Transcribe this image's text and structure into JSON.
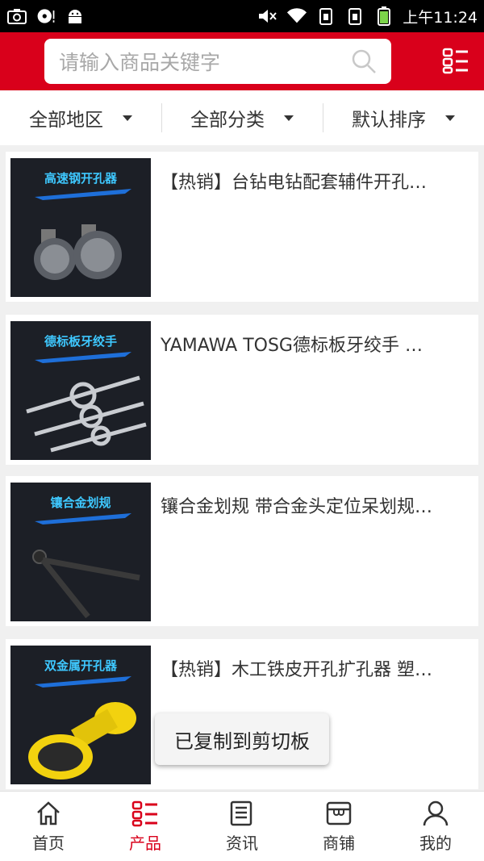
{
  "status_bar": {
    "time": "上午11:24",
    "icons": [
      "screenshot-icon",
      "media-disc-icon",
      "android-icon",
      "mute-icon",
      "wifi-icon",
      "sim-icon",
      "sim-icon",
      "battery-icon"
    ]
  },
  "header": {
    "search_placeholder": "请输入商品关键字",
    "accent_color": "#d9001b"
  },
  "filters": [
    {
      "label": "全部地区"
    },
    {
      "label": "全部分类"
    },
    {
      "label": "默认排序"
    }
  ],
  "products": [
    {
      "title": "【热销】台钻电钻配套辅件开孔…",
      "thumb_label": "高速钢开孔器"
    },
    {
      "title": "YAMAWA TOSG德标板牙绞手 …",
      "thumb_label": "德标板牙绞手"
    },
    {
      "title": "镶合金划规 带合金头定位呆划规…",
      "thumb_label": "镶合金划规"
    },
    {
      "title": "【热销】木工铁皮开孔扩孔器 塑…",
      "thumb_label": "双金属开孔器"
    }
  ],
  "toast": "已复制到剪切板",
  "bottom_nav": [
    {
      "label": "首页",
      "icon": "home-icon"
    },
    {
      "label": "产品",
      "icon": "product-list-icon",
      "active": true
    },
    {
      "label": "资讯",
      "icon": "news-icon"
    },
    {
      "label": "商铺",
      "icon": "store-icon"
    },
    {
      "label": "我的",
      "icon": "user-icon"
    }
  ]
}
